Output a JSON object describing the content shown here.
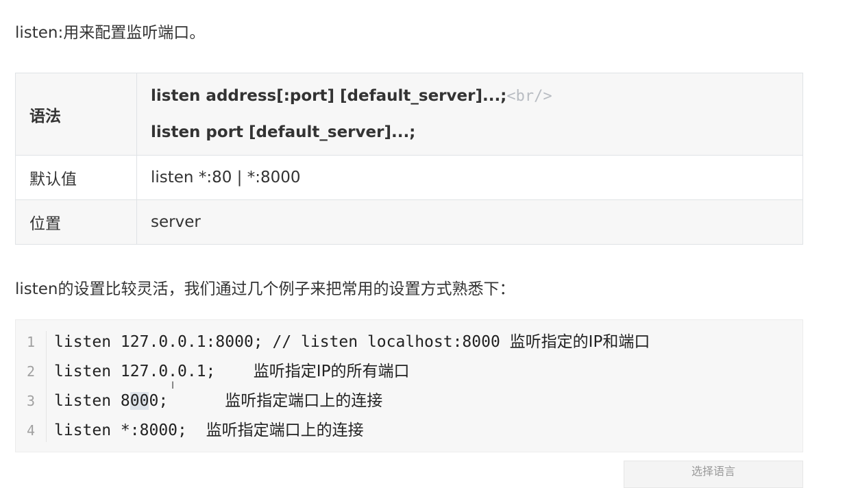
{
  "intro": "listen:用来配置监听端口。",
  "table": {
    "syntax_label": "语法",
    "syntax_line1": "listen address[:port] [default_server]...;",
    "syntax_br": "<br/>",
    "syntax_line2": "listen port [default_server]...;",
    "default_label": "默认值",
    "default_value": "listen *:80 | *:8000",
    "position_label": "位置",
    "position_value": "server"
  },
  "description": "listen的设置比较灵活，我们通过几个例子来把常用的设置方式熟悉下：",
  "code": {
    "lines": [
      {
        "num": "1",
        "code": "listen 127.0.0.1:8000; // listen localhost:8000 ",
        "comment": "监听指定的IP和端口"
      },
      {
        "num": "2",
        "code": "listen 127.0.0.1;    ",
        "comment": "监听指定IP的所有端口"
      },
      {
        "num": "3",
        "pre": "listen 8",
        "hl": "00",
        "post": "0;      ",
        "comment": "监听指定端口上的连接"
      },
      {
        "num": "4",
        "code": "listen *:8000;  ",
        "comment": "监听指定端口上的连接"
      }
    ]
  },
  "language_button": "选择语言"
}
